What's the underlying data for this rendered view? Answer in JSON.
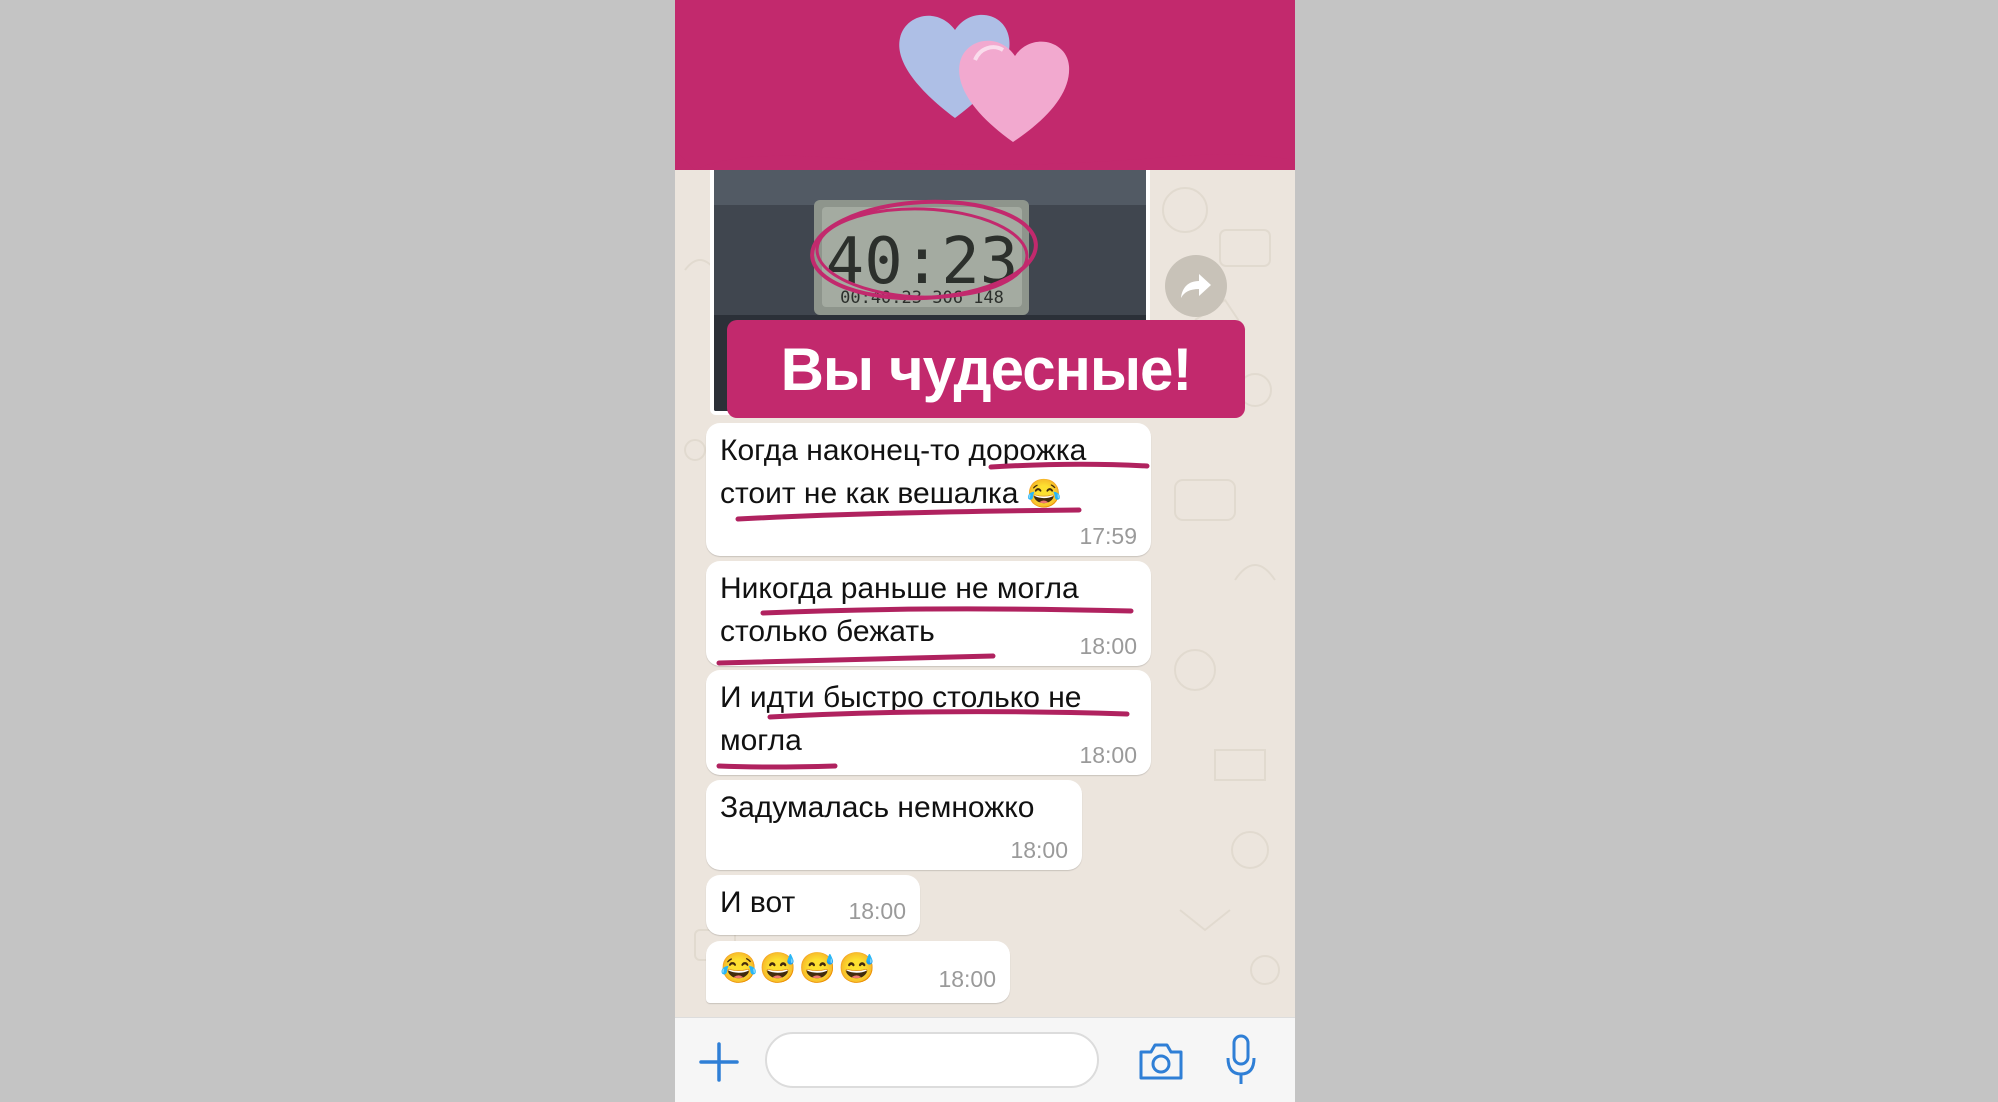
{
  "sticker": {
    "text": "Вы чудесные!"
  },
  "photo": {
    "display_main": "40:23",
    "display_sub": "00:40:23 306 148"
  },
  "messages": [
    {
      "line1": "Когда наконец-то дорожка",
      "line2": "стоит не как вешалка",
      "emoji": "😂",
      "time": "17:59"
    },
    {
      "line1": "Никогда раньше не могла",
      "line2": "столько бежать",
      "time": "18:00"
    },
    {
      "line1": "И идти быстро столько не",
      "line2": "могла",
      "time": "18:00"
    },
    {
      "line1": "Задумалась немножко",
      "time": "18:00"
    },
    {
      "line1": "И вот",
      "time": "18:00"
    },
    {
      "emojis": [
        "😂",
        "😅",
        "😅",
        "😅"
      ],
      "time": "18:00"
    }
  ],
  "input": {
    "placeholder": ""
  },
  "colors": {
    "brand": "#c2296d",
    "chat_bg": "#ece5dd",
    "accent": "#2f7fd6"
  },
  "icons": [
    "hearts-sticker",
    "forward-icon",
    "plus-icon",
    "camera-icon",
    "microphone-icon"
  ]
}
